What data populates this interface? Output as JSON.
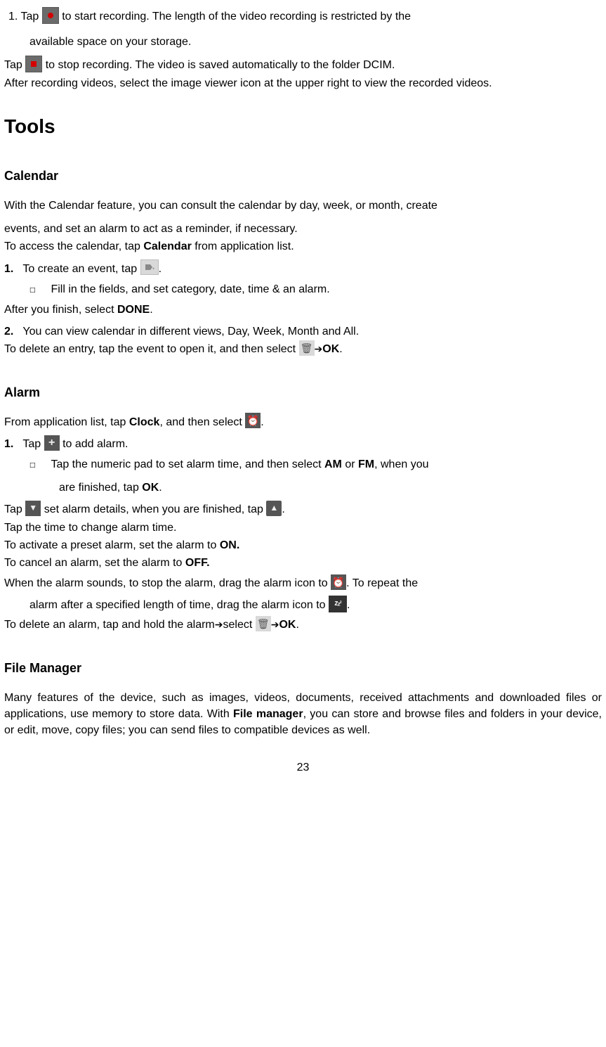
{
  "recording": {
    "item1_pre": "1.   Tap ",
    "item1_post": " to start recording. The length of the video recording is restricted by the",
    "item1_cont": "available space on your storage.",
    "tap_stop_pre": "Tap ",
    "tap_stop_post": " to stop recording. The video is saved automatically to the folder DCIM.",
    "after_rec": "After recording videos, select the image viewer icon at the upper right to view the recorded videos."
  },
  "tools_heading": "Tools",
  "calendar": {
    "heading": "Calendar",
    "intro1": "With the Calendar feature, you can consult the calendar by day, week, or month, create",
    "intro2": "events, and set an alarm to act as a reminder, if necessary.",
    "access_pre": "To access the calendar, tap ",
    "access_bold": "Calendar",
    "access_post": " from application list.",
    "step1_num": "1.",
    "step1_pre": "To create an event, tap ",
    "step1_post": ".",
    "bullet_fill": "Fill in the fields, and set category, date, time & an alarm.",
    "after_finish_pre": "After you finish, select ",
    "after_finish_bold": "DONE",
    "after_finish_post": ".",
    "step2_num": "2.",
    "step2_text": "You can view calendar in different views, Day, Week, Month and All.",
    "delete_pre": "To delete an entry, tap the event to open it, and then select ",
    "delete_ok": "OK",
    "delete_post": "."
  },
  "alarm": {
    "heading": "Alarm",
    "from_pre": "From application list, tap ",
    "from_bold": "Clock",
    "from_mid": ", and then select ",
    "from_post": ".",
    "step1_num": "1.",
    "step1_pre": "Tap ",
    "step1_post": " to add alarm.",
    "bullet_pre": "Tap the numeric pad to set alarm time, and then select ",
    "bullet_am": "AM",
    "bullet_or": " or ",
    "bullet_fm": "FM",
    "bullet_post": ", when you",
    "bullet_cont_pre": "are finished, tap ",
    "bullet_cont_ok": "OK",
    "bullet_cont_post": ".",
    "tap_details_pre": "Tap ",
    "tap_details_mid": " set alarm details, when you are finished, tap ",
    "tap_details_post": ".",
    "tap_time": "Tap the time to change alarm time.",
    "activate_pre": "To activate a preset alarm, set the alarm to ",
    "activate_on": "ON.",
    "cancel_pre": "To cancel an alarm, set the alarm to ",
    "cancel_off": "OFF.",
    "sounds_pre": "When the alarm sounds, to stop the alarm, drag the alarm icon to ",
    "sounds_post": ". To repeat the",
    "repeat_pre": "alarm after a specified length of time, drag the alarm icon to ",
    "repeat_post": ".",
    "delete_pre": "To delete an alarm, tap and hold the alarm",
    "delete_sel": "select ",
    "delete_ok": "OK",
    "delete_post": "."
  },
  "filemanager": {
    "heading": "File Manager",
    "body_pre": "Many features of the device, such as images, videos, documents, received attachments and downloaded files or applications, use memory to store data. With ",
    "body_bold": "File manager",
    "body_post": ", you can store and browse files and folders in your device, or edit, move, copy files; you can send files to compatible devices as well."
  },
  "page_number": "23"
}
